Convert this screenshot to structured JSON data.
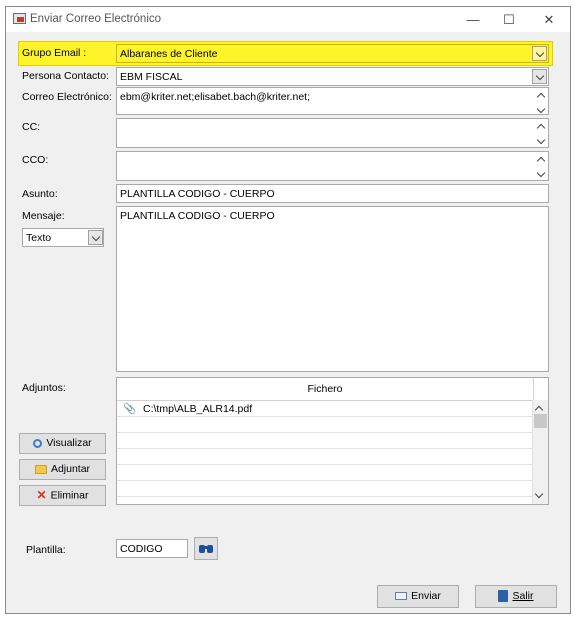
{
  "window": {
    "title": "Enviar Correo Electrónico"
  },
  "controls": {
    "minimize": "—",
    "maximize": "☐",
    "close": "✕"
  },
  "fields": {
    "grupo_email": {
      "label": "Grupo Email :",
      "value": "Albaranes de Cliente"
    },
    "persona_contacto": {
      "label": "Persona Contacto:",
      "value": "EBM FISCAL"
    },
    "correo": {
      "label": "Correo Electrónico:",
      "value": "ebm@kriter.net;elisabet.bach@kriter.net;"
    },
    "cc": {
      "label": "CC:",
      "value": ""
    },
    "cco": {
      "label": "CCO:",
      "value": ""
    },
    "asunto": {
      "label": "Asunto:",
      "value": "PLANTILLA CODIGO - CUERPO"
    },
    "mensaje": {
      "label": "Mensaje:",
      "value": "PLANTILLA CODIGO - CUERPO",
      "format": "Texto"
    },
    "plantilla": {
      "label": "Plantilla:",
      "value": "CODIGO"
    }
  },
  "adjuntos": {
    "label": "Adjuntos:",
    "column": "Fichero",
    "files": [
      "C:\\tmp\\ALB_ALR14.pdf"
    ]
  },
  "buttons": {
    "visualizar": "Visualizar",
    "adjuntar": "Adjuntar",
    "eliminar": "Eliminar",
    "enviar": "Enviar",
    "salir": "Salir"
  },
  "colors": {
    "highlight": "#fff32a",
    "delete": "#e0301e",
    "search": "#3a7bd5"
  }
}
